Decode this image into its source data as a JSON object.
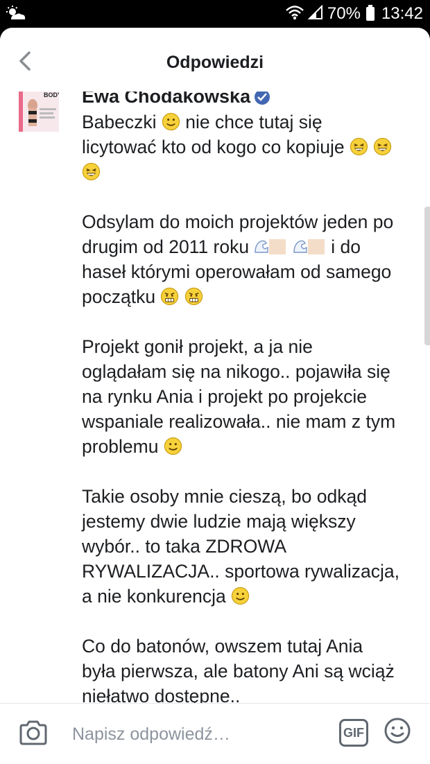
{
  "status_bar": {
    "battery": "70%",
    "time": "13:42"
  },
  "header": {
    "title": "Odpowiedzi"
  },
  "post": {
    "author": "Ewa Chodakowska",
    "paragraphs": [
      {
        "lines": [
          "Babeczki",
          "nie chce tutaj się",
          "licytować kto od kogo co kopiuje"
        ]
      },
      {
        "lines": [
          "Odsylam do moich projektów jeden po",
          "drugim od 2011 roku",
          "i do",
          "haseł którymi operowałam od samego",
          "początku"
        ]
      },
      {
        "lines": [
          "Projekt gonił projekt, a ja nie",
          "oglądałam się na nikogo.. pojawiła się",
          "na rynku Ania i projekt po projekcie",
          "wspaniale realizowała.. nie mam z tym",
          "problemu"
        ]
      },
      {
        "lines": [
          "Takie osoby mnie cieszą, bo odkąd",
          "jestemy dwie ludzie mają większy",
          "wybór.. to taka ZDROWA",
          "RYWALIZACJA.. sportowa rywalizacja,",
          "a nie konkurencja"
        ]
      },
      {
        "lines": [
          "Co do batonów, owszem tutaj Ania",
          "była pierwsza, ale batony Ani są wciąż",
          "niełatwo dostępne.."
        ]
      }
    ],
    "thumb_label": "BODY"
  },
  "composer": {
    "placeholder": "Napisz odpowiedź…",
    "gif_label": "GIF"
  },
  "colors": {
    "accent": "#4267b2",
    "text": "#1c1e21",
    "muted": "#8d949e"
  }
}
